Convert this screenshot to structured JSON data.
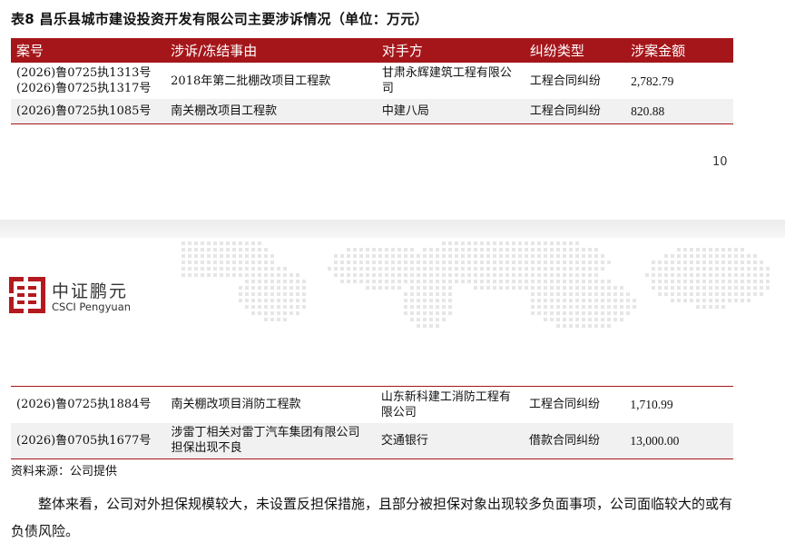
{
  "title": "表8 昌乐县城市建设投资开发有限公司主要涉诉情况（单位：万元）",
  "table": {
    "headers": [
      "案号",
      "涉诉/冻结事由",
      "对手方",
      "纠纷类型",
      "涉案金额"
    ],
    "rows": [
      {
        "case": "(2026)鲁0725执1313号\n(2026)鲁0725执1317号",
        "reason": "2018年第二批棚改项目工程款",
        "party": "甘肃永辉建筑工程有限公司",
        "type": "工程合同纠纷",
        "amount": "2,782.79"
      },
      {
        "case": "(2026)鲁0725执1085号",
        "reason": "南关棚改项目工程款",
        "party": "中建八局",
        "type": "工程合同纠纷",
        "amount": "820.88"
      },
      {
        "case": "(2026)鲁0725执1884号",
        "reason": "南关棚改项目消防工程款",
        "party": "山东新科建工消防工程有限公司",
        "type": "工程合同纠纷",
        "amount": "1,710.99"
      },
      {
        "case": "(2026)鲁0705执1677号",
        "reason": "涉雷丁相关对雷丁汽车集团有限公司担保出现不良",
        "party": "交通银行",
        "type": "借款合同纠纷",
        "amount": "13,000.00"
      }
    ]
  },
  "page_number": "10",
  "logo": {
    "cn": "中证鹏元",
    "en": "CSCI Pengyuan",
    "color": "#b3191e"
  },
  "source_note": "资料来源：公司提供",
  "paragraph": "整体来看，公司对外担保规模较大，未设置反担保措施，且部分被担保对象出现较多负面事项，公司面临较大的或有负债风险。",
  "colors": {
    "header_bg": "#a5161a",
    "alt_row": "#f1f1f1"
  }
}
